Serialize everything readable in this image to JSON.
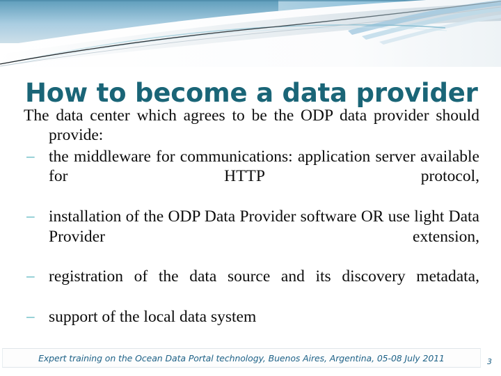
{
  "slide": {
    "title": "How to become a data provider",
    "theme_colors": {
      "title": "#1a6577",
      "bullet_dash": "#72c0c9",
      "footer_text": "#1f6287",
      "body_text": "#0c0c0c",
      "header_blue_dark": "#5596b6",
      "header_blue_light": "#cfe3ee",
      "header_line_dark": "#2b3438"
    },
    "body": {
      "intro_paragraph": "The data center which agrees to be the ODP data provider should provide:",
      "bullets": [
        {
          "marker": "–",
          "text": "the middleware for communications: application server available for HTTP protocol,"
        },
        {
          "marker": "–",
          "text": "installation of the ODP Data Provider software OR use light Data Provider extension,"
        },
        {
          "marker": "–",
          "text": "registration of the data source and its discovery metadata,"
        },
        {
          "marker": "–",
          "text": "support of the local data system"
        }
      ]
    },
    "footer": {
      "text": "Expert training on the Ocean Data Portal technology, Buenos Aires, Argentina, 05-08 July 2011",
      "page_number": "3"
    }
  }
}
